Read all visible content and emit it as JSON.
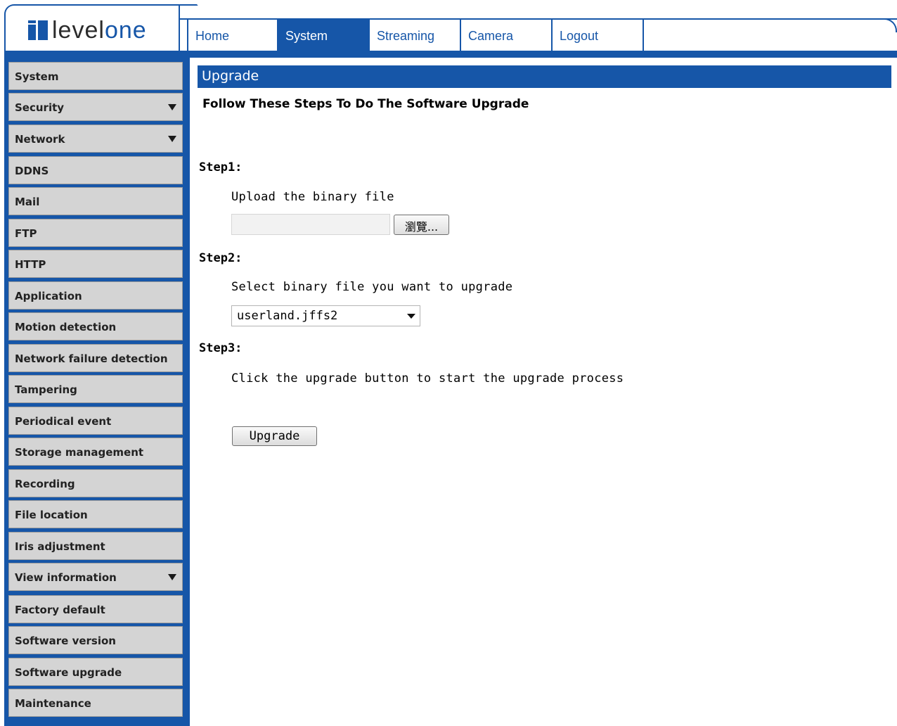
{
  "brand": {
    "logo_part1": "level",
    "logo_part2": "one",
    "color": "#1656a8"
  },
  "tabs": [
    {
      "label": "Home"
    },
    {
      "label": "System",
      "active": true
    },
    {
      "label": "Streaming"
    },
    {
      "label": "Camera"
    },
    {
      "label": "Logout"
    }
  ],
  "sidebar": {
    "items": [
      {
        "label": "System"
      },
      {
        "label": "Security",
        "has_submenu": true
      },
      {
        "label": "Network",
        "has_submenu": true
      },
      {
        "label": "DDNS"
      },
      {
        "label": "Mail"
      },
      {
        "label": "FTP"
      },
      {
        "label": "HTTP"
      },
      {
        "label": "Application"
      },
      {
        "label": "Motion detection"
      },
      {
        "label": "Network failure detection"
      },
      {
        "label": "Tampering"
      },
      {
        "label": "Periodical event"
      },
      {
        "label": "Storage management"
      },
      {
        "label": "Recording"
      },
      {
        "label": "File location"
      },
      {
        "label": "Iris adjustment"
      },
      {
        "label": "View information",
        "has_submenu": true
      },
      {
        "label": "Factory default"
      },
      {
        "label": "Software version"
      },
      {
        "label": "Software upgrade"
      },
      {
        "label": "Maintenance"
      }
    ]
  },
  "main": {
    "title": "Upgrade",
    "subtitle": "Follow These Steps To Do The Software Upgrade",
    "step1": {
      "label": "Step1:",
      "text": "Upload the binary file",
      "file_value": "",
      "browse_label": "瀏覽..."
    },
    "step2": {
      "label": "Step2:",
      "text": "Select binary file you want to upgrade",
      "selected": "userland.jffs2"
    },
    "step3": {
      "label": "Step3:",
      "text": "Click the upgrade button to start the upgrade process",
      "button_label": "Upgrade"
    }
  }
}
